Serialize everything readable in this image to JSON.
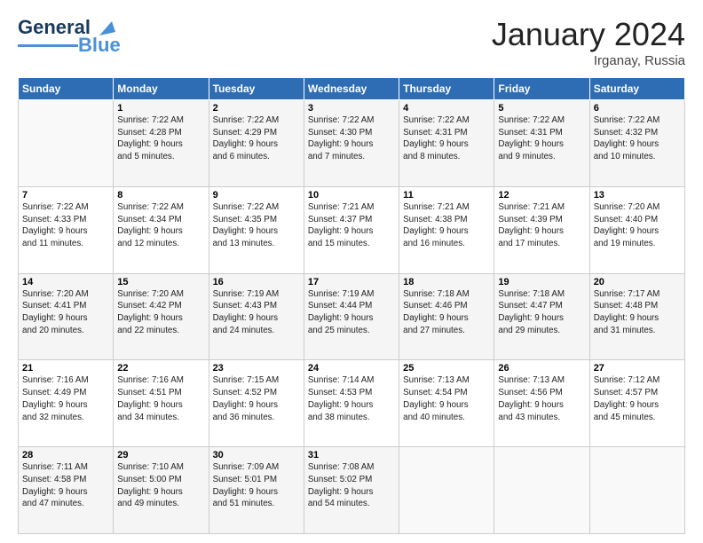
{
  "logo": {
    "line1": "General",
    "line2": "Blue"
  },
  "title": "January 2024",
  "location": "Irganay, Russia",
  "days_header": [
    "Sunday",
    "Monday",
    "Tuesday",
    "Wednesday",
    "Thursday",
    "Friday",
    "Saturday"
  ],
  "weeks": [
    [
      {
        "day": "",
        "info": ""
      },
      {
        "day": "1",
        "info": "Sunrise: 7:22 AM\nSunset: 4:28 PM\nDaylight: 9 hours\nand 5 minutes."
      },
      {
        "day": "2",
        "info": "Sunrise: 7:22 AM\nSunset: 4:29 PM\nDaylight: 9 hours\nand 6 minutes."
      },
      {
        "day": "3",
        "info": "Sunrise: 7:22 AM\nSunset: 4:30 PM\nDaylight: 9 hours\nand 7 minutes."
      },
      {
        "day": "4",
        "info": "Sunrise: 7:22 AM\nSunset: 4:31 PM\nDaylight: 9 hours\nand 8 minutes."
      },
      {
        "day": "5",
        "info": "Sunrise: 7:22 AM\nSunset: 4:31 PM\nDaylight: 9 hours\nand 9 minutes."
      },
      {
        "day": "6",
        "info": "Sunrise: 7:22 AM\nSunset: 4:32 PM\nDaylight: 9 hours\nand 10 minutes."
      }
    ],
    [
      {
        "day": "7",
        "info": "Sunrise: 7:22 AM\nSunset: 4:33 PM\nDaylight: 9 hours\nand 11 minutes."
      },
      {
        "day": "8",
        "info": "Sunrise: 7:22 AM\nSunset: 4:34 PM\nDaylight: 9 hours\nand 12 minutes."
      },
      {
        "day": "9",
        "info": "Sunrise: 7:22 AM\nSunset: 4:35 PM\nDaylight: 9 hours\nand 13 minutes."
      },
      {
        "day": "10",
        "info": "Sunrise: 7:21 AM\nSunset: 4:37 PM\nDaylight: 9 hours\nand 15 minutes."
      },
      {
        "day": "11",
        "info": "Sunrise: 7:21 AM\nSunset: 4:38 PM\nDaylight: 9 hours\nand 16 minutes."
      },
      {
        "day": "12",
        "info": "Sunrise: 7:21 AM\nSunset: 4:39 PM\nDaylight: 9 hours\nand 17 minutes."
      },
      {
        "day": "13",
        "info": "Sunrise: 7:20 AM\nSunset: 4:40 PM\nDaylight: 9 hours\nand 19 minutes."
      }
    ],
    [
      {
        "day": "14",
        "info": "Sunrise: 7:20 AM\nSunset: 4:41 PM\nDaylight: 9 hours\nand 20 minutes."
      },
      {
        "day": "15",
        "info": "Sunrise: 7:20 AM\nSunset: 4:42 PM\nDaylight: 9 hours\nand 22 minutes."
      },
      {
        "day": "16",
        "info": "Sunrise: 7:19 AM\nSunset: 4:43 PM\nDaylight: 9 hours\nand 24 minutes."
      },
      {
        "day": "17",
        "info": "Sunrise: 7:19 AM\nSunset: 4:44 PM\nDaylight: 9 hours\nand 25 minutes."
      },
      {
        "day": "18",
        "info": "Sunrise: 7:18 AM\nSunset: 4:46 PM\nDaylight: 9 hours\nand 27 minutes."
      },
      {
        "day": "19",
        "info": "Sunrise: 7:18 AM\nSunset: 4:47 PM\nDaylight: 9 hours\nand 29 minutes."
      },
      {
        "day": "20",
        "info": "Sunrise: 7:17 AM\nSunset: 4:48 PM\nDaylight: 9 hours\nand 31 minutes."
      }
    ],
    [
      {
        "day": "21",
        "info": "Sunrise: 7:16 AM\nSunset: 4:49 PM\nDaylight: 9 hours\nand 32 minutes."
      },
      {
        "day": "22",
        "info": "Sunrise: 7:16 AM\nSunset: 4:51 PM\nDaylight: 9 hours\nand 34 minutes."
      },
      {
        "day": "23",
        "info": "Sunrise: 7:15 AM\nSunset: 4:52 PM\nDaylight: 9 hours\nand 36 minutes."
      },
      {
        "day": "24",
        "info": "Sunrise: 7:14 AM\nSunset: 4:53 PM\nDaylight: 9 hours\nand 38 minutes."
      },
      {
        "day": "25",
        "info": "Sunrise: 7:13 AM\nSunset: 4:54 PM\nDaylight: 9 hours\nand 40 minutes."
      },
      {
        "day": "26",
        "info": "Sunrise: 7:13 AM\nSunset: 4:56 PM\nDaylight: 9 hours\nand 43 minutes."
      },
      {
        "day": "27",
        "info": "Sunrise: 7:12 AM\nSunset: 4:57 PM\nDaylight: 9 hours\nand 45 minutes."
      }
    ],
    [
      {
        "day": "28",
        "info": "Sunrise: 7:11 AM\nSunset: 4:58 PM\nDaylight: 9 hours\nand 47 minutes."
      },
      {
        "day": "29",
        "info": "Sunrise: 7:10 AM\nSunset: 5:00 PM\nDaylight: 9 hours\nand 49 minutes."
      },
      {
        "day": "30",
        "info": "Sunrise: 7:09 AM\nSunset: 5:01 PM\nDaylight: 9 hours\nand 51 minutes."
      },
      {
        "day": "31",
        "info": "Sunrise: 7:08 AM\nSunset: 5:02 PM\nDaylight: 9 hours\nand 54 minutes."
      },
      {
        "day": "",
        "info": ""
      },
      {
        "day": "",
        "info": ""
      },
      {
        "day": "",
        "info": ""
      }
    ]
  ]
}
